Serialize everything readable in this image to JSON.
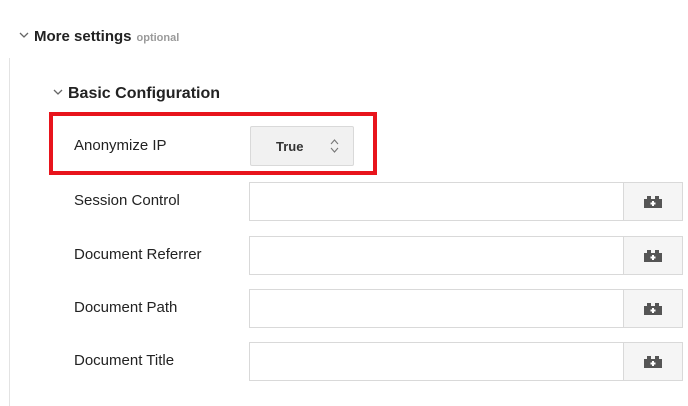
{
  "more_settings": {
    "title": "More settings",
    "optional_label": "optional",
    "expanded_icon": "chevron-down-icon"
  },
  "basic_configuration": {
    "title": "Basic Configuration",
    "expanded_icon": "chevron-down-icon"
  },
  "anonymize_ip": {
    "label": "Anonymize IP",
    "value": "True",
    "control_icon": "up-down-spinner-icon"
  },
  "fields": [
    {
      "label": "Session Control",
      "value": "",
      "button_icon": "variable-brick-icon"
    },
    {
      "label": "Document Referrer",
      "value": "",
      "button_icon": "variable-brick-icon"
    },
    {
      "label": "Document Path",
      "value": "",
      "button_icon": "variable-brick-icon"
    },
    {
      "label": "Document Title",
      "value": "",
      "button_icon": "variable-brick-icon"
    }
  ],
  "colors": {
    "highlight": "#e8141c",
    "optional_text": "#9a9a9a",
    "select_bg": "#f1f1f1",
    "button_bg": "#f5f5f5",
    "border": "#d9d9d9"
  }
}
